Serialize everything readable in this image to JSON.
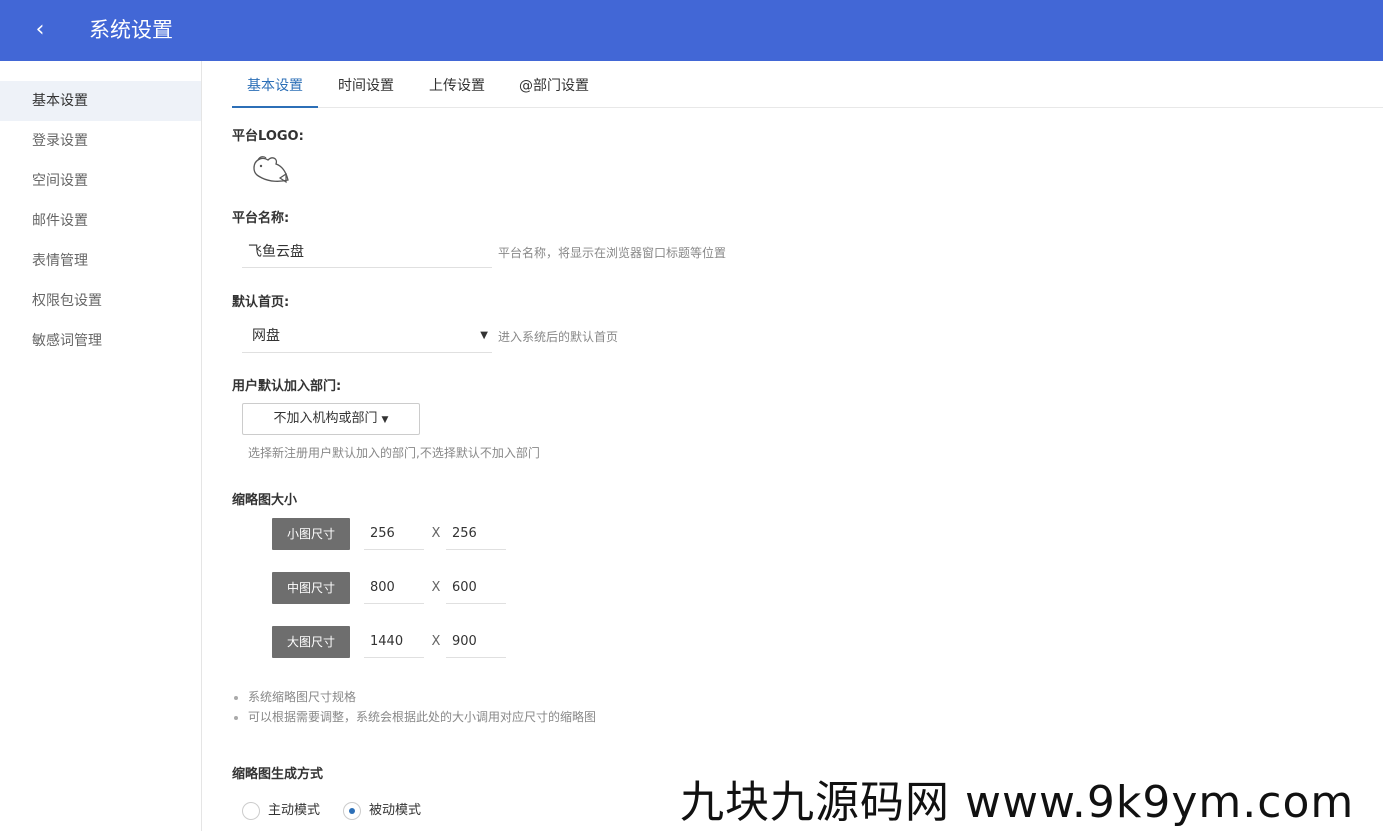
{
  "header": {
    "title": "系统设置",
    "back_icon": "‹"
  },
  "sidebar": {
    "items": [
      {
        "label": "基本设置",
        "active": true
      },
      {
        "label": "登录设置",
        "active": false
      },
      {
        "label": "空间设置",
        "active": false
      },
      {
        "label": "邮件设置",
        "active": false
      },
      {
        "label": "表情管理",
        "active": false
      },
      {
        "label": "权限包设置",
        "active": false
      },
      {
        "label": "敏感词管理",
        "active": false
      }
    ]
  },
  "tabs": [
    {
      "label": "基本设置",
      "active": true
    },
    {
      "label": "时间设置",
      "active": false
    },
    {
      "label": "上传设置",
      "active": false
    },
    {
      "label": "@部门设置",
      "active": false
    }
  ],
  "logo": {
    "label": "平台LOGO:"
  },
  "platform_name": {
    "label": "平台名称:",
    "value": "飞鱼云盘",
    "hint": "平台名称，将显示在浏览器窗口标题等位置"
  },
  "default_home": {
    "label": "默认首页:",
    "value": "网盘",
    "hint": "进入系统后的默认首页"
  },
  "default_dept": {
    "label": "用户默认加入部门:",
    "button": "不加入机构或部门",
    "hint": "选择新注册用户默认加入的部门,不选择默认不加入部门"
  },
  "thumb": {
    "label": "缩略图大小",
    "sizes": [
      {
        "name": "小图尺寸",
        "w": "256",
        "h": "256"
      },
      {
        "name": "中图尺寸",
        "w": "800",
        "h": "600"
      },
      {
        "name": "大图尺寸",
        "w": "1440",
        "h": "900"
      }
    ],
    "times": "X",
    "notes": [
      "系统缩略图尺寸规格",
      "可以根据需要调整，系统会根据此处的大小调用对应尺寸的缩略图"
    ]
  },
  "thumb_mode": {
    "label": "缩略图生成方式",
    "options": [
      {
        "label": "主动模式",
        "checked": false
      },
      {
        "label": "被动模式",
        "checked": true
      }
    ]
  },
  "watermark": "九块九源码网 www.9k9ym.com",
  "colors": {
    "header": "#4267d6",
    "accent": "#2c6fb7",
    "size_button": "#6e6e6e"
  }
}
